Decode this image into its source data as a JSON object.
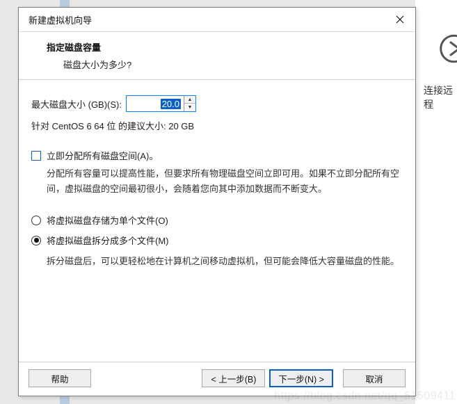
{
  "background": {
    "sidebar_text": "连接远程"
  },
  "dialog": {
    "title": "新建虚拟机向导",
    "header": {
      "title": "指定磁盘容量",
      "subtitle": "磁盘大小为多少?"
    },
    "size": {
      "label": "最大磁盘大小 (GB)(S):",
      "value": "20.0",
      "hint": "针对 CentOS 6 64 位 的建议大小: 20 GB"
    },
    "allocate": {
      "label": "立即分配所有磁盘空间(A)。",
      "desc": "分配所有容量可以提高性能，但要求所有物理磁盘空间立即可用。如果不立即分配所有空间，虚拟磁盘的空间最初很小，会随着您向其中添加数据而不断变大。"
    },
    "store": {
      "single": "将虚拟磁盘存储为单个文件(O)",
      "split": "将虚拟磁盘拆分成多个文件(M)",
      "split_desc": "拆分磁盘后，可以更轻松地在计算机之间移动虚拟机，但可能会降低大容量磁盘的性能。"
    },
    "buttons": {
      "help": "帮助",
      "back": "< 上一步(B)",
      "next": "下一步(N) >",
      "cancel": "取消"
    }
  },
  "watermark": "https://blog.csdn.net/qq_51509411"
}
